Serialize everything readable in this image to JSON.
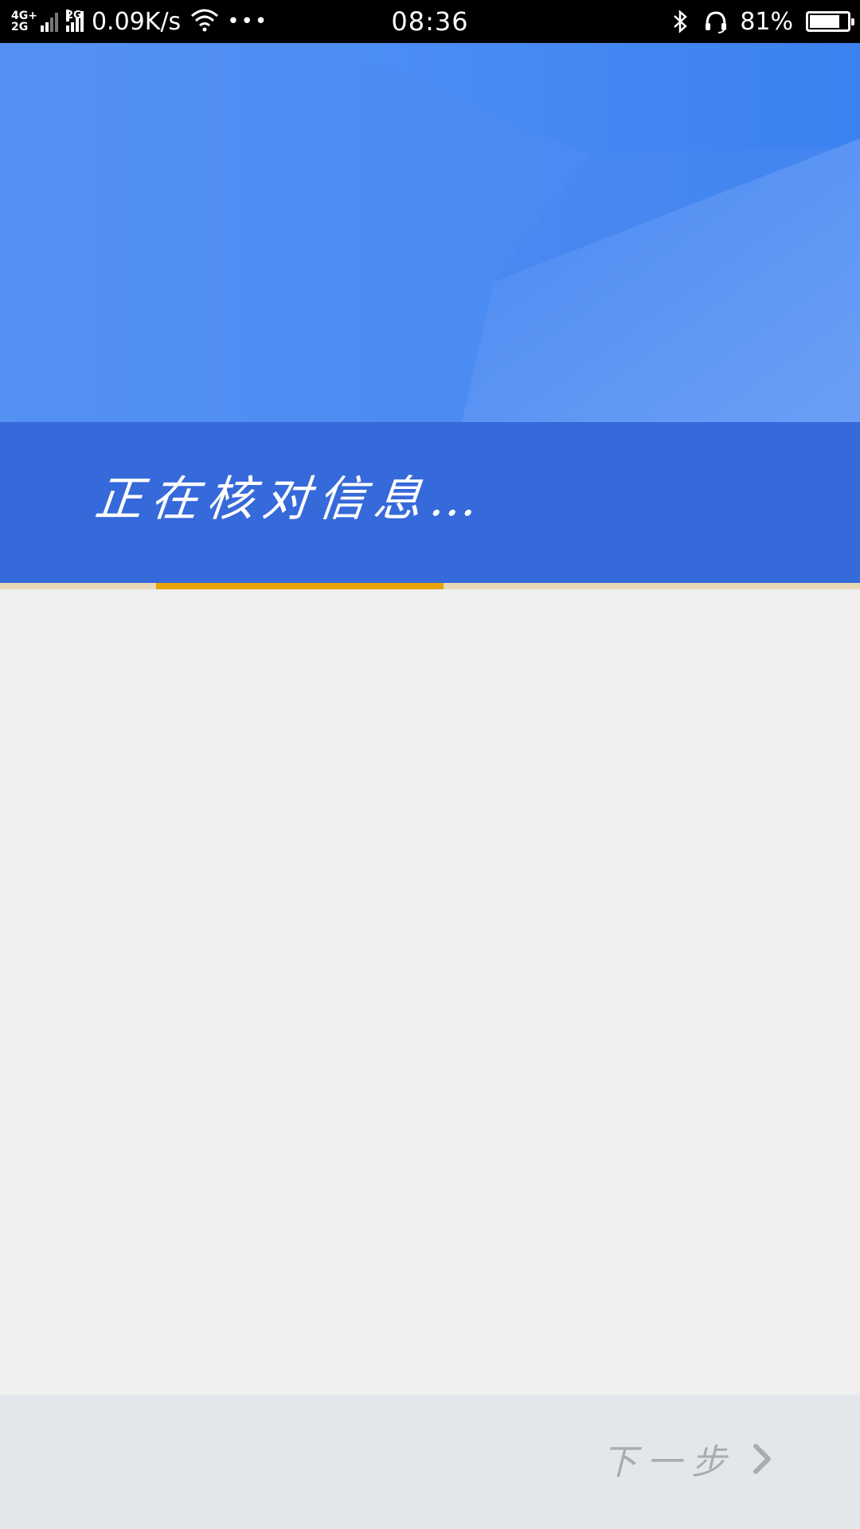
{
  "status_bar": {
    "net_top": "4G+",
    "net_bottom": "2G",
    "net2_label": "2G",
    "speed": "0.09K/s",
    "dots": "•••",
    "time": "08:36",
    "battery_pct": "81%",
    "battery_level": 0.81
  },
  "banner": {
    "text": "正在核对信息…"
  },
  "progress": {
    "fraction": 0.334
  },
  "footer": {
    "next_label": "下一步"
  },
  "colors": {
    "hero_blue": "#4b8af2",
    "banner_blue": "#3669d9",
    "progress_orange": "#e8a400",
    "footer_bg": "#e3e7eb"
  }
}
